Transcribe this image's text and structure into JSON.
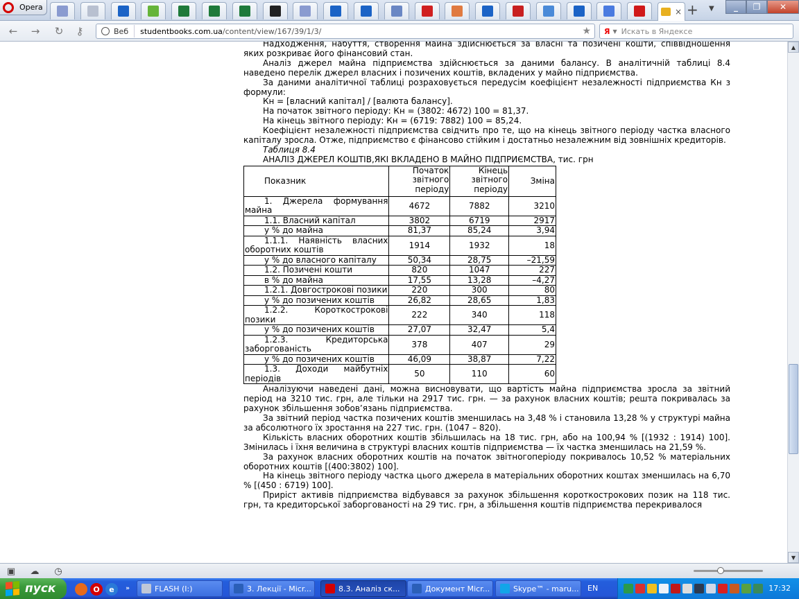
{
  "browser": {
    "menu_label": "Opera",
    "tabs": [
      {
        "icon": "page-icon",
        "color": "#8a9bd0"
      },
      {
        "icon": "page-icon",
        "color": "#b8c0d0"
      },
      {
        "icon": "info-icon",
        "color": "#1b63c6"
      },
      {
        "icon": "apple-icon",
        "color": "#66b43a"
      },
      {
        "icon": "excel-icon",
        "color": "#1f7a3a"
      },
      {
        "icon": "excel-icon",
        "color": "#1f7a3a"
      },
      {
        "icon": "excel-icon",
        "color": "#1f7a3a"
      },
      {
        "icon": "li-icon",
        "color": "#222222"
      },
      {
        "icon": "page-icon",
        "color": "#8a9bd0"
      },
      {
        "icon": "upload-icon",
        "color": "#1b63c6"
      },
      {
        "icon": "upload-icon",
        "color": "#1b63c6"
      },
      {
        "icon": "document-icon",
        "color": "#6a87c4"
      },
      {
        "icon": "bookbox-icon",
        "color": "#d02020"
      },
      {
        "icon": "chart-icon",
        "color": "#e07a40"
      },
      {
        "icon": "upload-icon",
        "color": "#1b63c6"
      },
      {
        "icon": "mail-icon",
        "color": "#c82020"
      },
      {
        "icon": "es-icon",
        "color": "#4a8ad8"
      },
      {
        "icon": "upload-icon",
        "color": "#1b63c6"
      },
      {
        "icon": "google-icon",
        "color": "#4a7be0"
      },
      {
        "icon": "x-icon",
        "color": "#d01818"
      }
    ],
    "active_tab_icon": "graduation-cap-icon",
    "close_glyph": "×",
    "add_glyph": "+",
    "address_badge": "Веб",
    "url_host": "studentbooks.com.ua",
    "url_path": "/content/view/167/39/1/3/",
    "search_engine_glyph": "Я",
    "search_placeholder": "Искать в Яндексе"
  },
  "document": {
    "paragraphs_top": [
      "Надходження, набуття, створення майна здійснюється за власні та позичені кошти, співвідношення яких розкриває його фінансовий стан.",
      "Аналіз джерел майна підприємства здійснюється за даними балансу. В аналітичній таблиці 8.4 наведено перелік джерел власних і позичених коштів, вкладених у майно підприємства.",
      "За даними аналітичної таблиці розраховується передусім коефіцієнт незалежності підприємства Кн з формули:",
      "Кн = [власний капітал] / [валюта балансу].",
      "На початок звітного періоду: Кн = (3802: 4672) 100 = 81,37.",
      "На кінець звітного періоду: Кн = (6719: 7882) 100 = 85,24.",
      "Коефіцієнт незалежності підприємства свідчить про те, що на кінець звітного періоду частка власного капіталу зросла. Отже, підприємство є фінансово стійким і достатньо незалежним від зовнішніх кредиторів."
    ],
    "table_caption": "Таблиця 8.4",
    "table_title": "АНАЛІЗ ДЖЕРЕЛ КОШТІВ,ЯКІ ВКЛАДЕНО В МАЙНО ПІДПРИЄМСТВА, тис. грн",
    "table": {
      "headers": [
        "Показник",
        "Початок звітного періоду",
        "Кінець звітного періоду",
        "Зміна"
      ],
      "rows": [
        [
          "1. Джерела формування майна",
          "4672",
          "7882",
          "3210"
        ],
        [
          "1.1. Власний капітал",
          "3802",
          "6719",
          "2917"
        ],
        [
          "у % до майна",
          "81,37",
          "85,24",
          "3,94"
        ],
        [
          "1.1.1. Наявність власних оборотних коштів",
          "1914",
          "1932",
          "18"
        ],
        [
          "у % до власного капіталу",
          "50,34",
          "28,75",
          "–21,59"
        ],
        [
          "1.2. Позичені кошти",
          "820",
          "1047",
          "227"
        ],
        [
          "в % до майна",
          "17,55",
          "13,28",
          "–4,27"
        ],
        [
          "1.2.1. Довгострокові позики",
          "220",
          "300",
          "80"
        ],
        [
          "у % до позичених коштів",
          "26,82",
          "28,65",
          "1,83"
        ],
        [
          "1.2.2. Короткострокові позики",
          "222",
          "340",
          "118"
        ],
        [
          "у % до позичених коштів",
          "27,07",
          "32,47",
          "5,4"
        ],
        [
          "1.2.3. Кредиторська заборгованість",
          "378",
          "407",
          "29"
        ],
        [
          "у % до позичених коштів",
          "46,09",
          "38,87",
          "7,22"
        ],
        [
          "1.3. Доходи майбутніх періодів",
          "50",
          "110",
          "60"
        ]
      ]
    },
    "paragraphs_bottom": [
      "Аналізуючи наведені дані, можна висновувати, що вартість майна підприємства зросла за звітний період на 3210 тис. грн, але тільки на 2917 тис. грн. — за рахунок власних коштів; решта покривалась за рахунок збільшення зобов’язань підприємства.",
      "За звітний період частка позичених коштів зменшилась на 3,48 % і становила 13,28 % у структурі майна за абсолютного їх зростання на 227 тис. грн. (1047 – 820).",
      "Кількість власних оборотних коштів збільшилась на 18 тис. грн, або на 100,94 % [(1932 : 1914) 100]. Змінилась і їхня величина в структурі власних коштів підприємства — їх частка зменшилась на 21,59 %.",
      "За рахунок власних оборотних коштів на початок звітногоперіоду покривалось 10,52 % матеріальних оборотних коштів [(400:3802) 100].",
      "На кінець звітного періоду частка цього джерела в матеріальних оборотних коштах зменшилась на 6,70 % [(450 : 6719) 100].",
      "Приріст активів підприємства відбувався за рахунок збільшення короткострокових позик на 118 тис. грн, та кредиторської заборгованості на 29 тис. грн, а збільшення коштів підприємства перекривалося"
    ]
  },
  "taskbar": {
    "start_label": "пуск",
    "windows": [
      {
        "label": "FLASH (I:)",
        "icon_color": "#c0c8d8",
        "active": false
      },
      {
        "label": "3. Лекції - Micr...",
        "icon_color": "#2b5fb8",
        "active": false
      },
      {
        "label": "8.3. Аналіз ск...",
        "icon_color": "#d40000",
        "active": true
      },
      {
        "label": "Документ Micr...",
        "icon_color": "#2b5fb8",
        "active": false
      },
      {
        "label": "Skype™ - maru...",
        "icon_color": "#12a5e8",
        "active": false
      }
    ],
    "language": "EN",
    "clock": "17:32"
  }
}
